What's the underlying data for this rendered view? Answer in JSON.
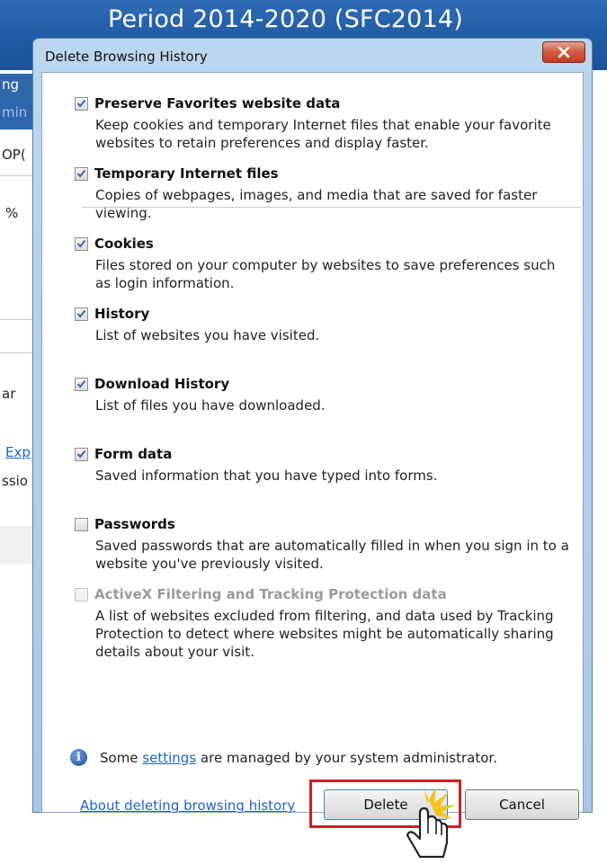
{
  "background": {
    "title": "Period 2014-2020 (SFC2014)",
    "fragments": {
      "ng": "ng",
      "min": "min",
      "op": "OP(",
      "pct": "%",
      "ar": "ar",
      "exp": "Exp",
      "sio": "ssio"
    }
  },
  "dialog": {
    "title": "Delete Browsing History",
    "close_symbol": "x",
    "options": [
      {
        "title": "Preserve Favorites website data",
        "checked": true,
        "disabled": false,
        "description": "Keep cookies and temporary Internet files that enable your favorite websites to retain preferences and display faster."
      },
      {
        "title": "Temporary Internet files",
        "checked": true,
        "disabled": false,
        "description": "Copies of webpages, images, and media that are saved for faster viewing."
      },
      {
        "title": "Cookies",
        "checked": true,
        "disabled": false,
        "description": "Files stored on your computer by websites to save preferences such as login information."
      },
      {
        "title": "History",
        "checked": true,
        "disabled": false,
        "description": "List of websites you have visited."
      },
      {
        "title": "Download History",
        "checked": true,
        "disabled": false,
        "description": "List of files you have downloaded."
      },
      {
        "title": "Form data",
        "checked": true,
        "disabled": false,
        "description": "Saved information that you have typed into forms."
      },
      {
        "title": "Passwords",
        "checked": false,
        "disabled": false,
        "description": "Saved passwords that are automatically filled in when you sign in to a website you've previously visited."
      },
      {
        "title": "ActiveX Filtering and Tracking Protection data",
        "checked": false,
        "disabled": true,
        "description": "A list of websites excluded from filtering, and data used by Tracking Protection to detect where websites might be automatically sharing details about your visit."
      }
    ],
    "admin_note": {
      "prefix": "Some ",
      "link": "settings",
      "suffix": " are managed by your system administrator."
    },
    "about_link": "About deleting browsing history",
    "buttons": {
      "delete": "Delete",
      "cancel": "Cancel"
    }
  },
  "colors": {
    "title_bar": "#1f5aa3",
    "highlight": "#d01f26",
    "link": "#1e64c8",
    "checkmark": "#3a5fb8"
  },
  "icons": {
    "info": "info-icon",
    "close": "close-icon",
    "cursor": "hand-pointer-icon",
    "check": "checkmark-icon"
  }
}
